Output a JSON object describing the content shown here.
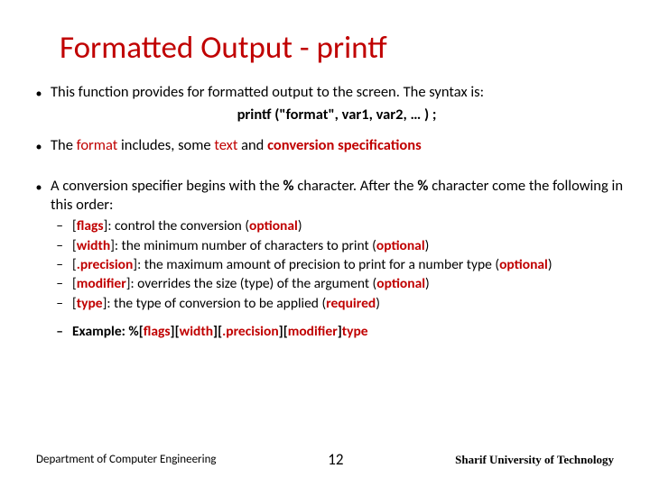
{
  "title": "Formatted Output - printf",
  "p1a": "This function provides for formatted output to the screen.  The syntax is:",
  "p1center": "printf (\"format\", var1, var2, … ) ;",
  "p2_a": "The ",
  "p2_b": "format",
  "p2_c": " includes, some ",
  "p2_d": "text",
  "p2_e": " and ",
  "p2_f": "conversion specifications",
  "p3_a": "A conversion specifier begins with the ",
  "p3_b": "%",
  "p3_c": " character.  After the ",
  "p3_d": "%",
  "p3_e": " character come the following in this order:",
  "sub": [
    {
      "k": "[",
      "kw": "flags",
      "k2": "]",
      "rest": ": control the conversion (",
      "opt": "optional",
      "end": ")"
    },
    {
      "k": "[",
      "kw": "width",
      "k2": "]",
      "rest": ": the  minimum number of characters to print (",
      "opt": "optional",
      "end": ")"
    },
    {
      "k": "[",
      "kw": ".precision",
      "k2": "]",
      "rest": ": the maximum amount of precision to print for a number type (",
      "opt": "optional",
      "end": ")"
    },
    {
      "k": "[",
      "kw": "modifier",
      "k2": "]",
      "rest": ": overrides the size (type) of the argument (",
      "opt": "optional",
      "end": ")"
    },
    {
      "k": "[",
      "kw": "type",
      "k2": "]",
      "rest": ": the type of conversion to be applied (",
      "opt": "required",
      "end": ")"
    }
  ],
  "ex_label": "Example:   %",
  "ex_1a": "[",
  "ex_1b": "flags",
  "ex_1c": "]",
  "ex_2a": "[",
  "ex_2b": "width",
  "ex_2c": "]",
  "ex_3a": "[",
  "ex_3b": ".precision",
  "ex_3c": "]",
  "ex_4a": "[",
  "ex_4b": "modifier",
  "ex_4c": "]",
  "ex_5": "type",
  "footer": {
    "dept": "Department of Computer Engineering",
    "page": "12",
    "univ": "Sharif University of Technology"
  }
}
